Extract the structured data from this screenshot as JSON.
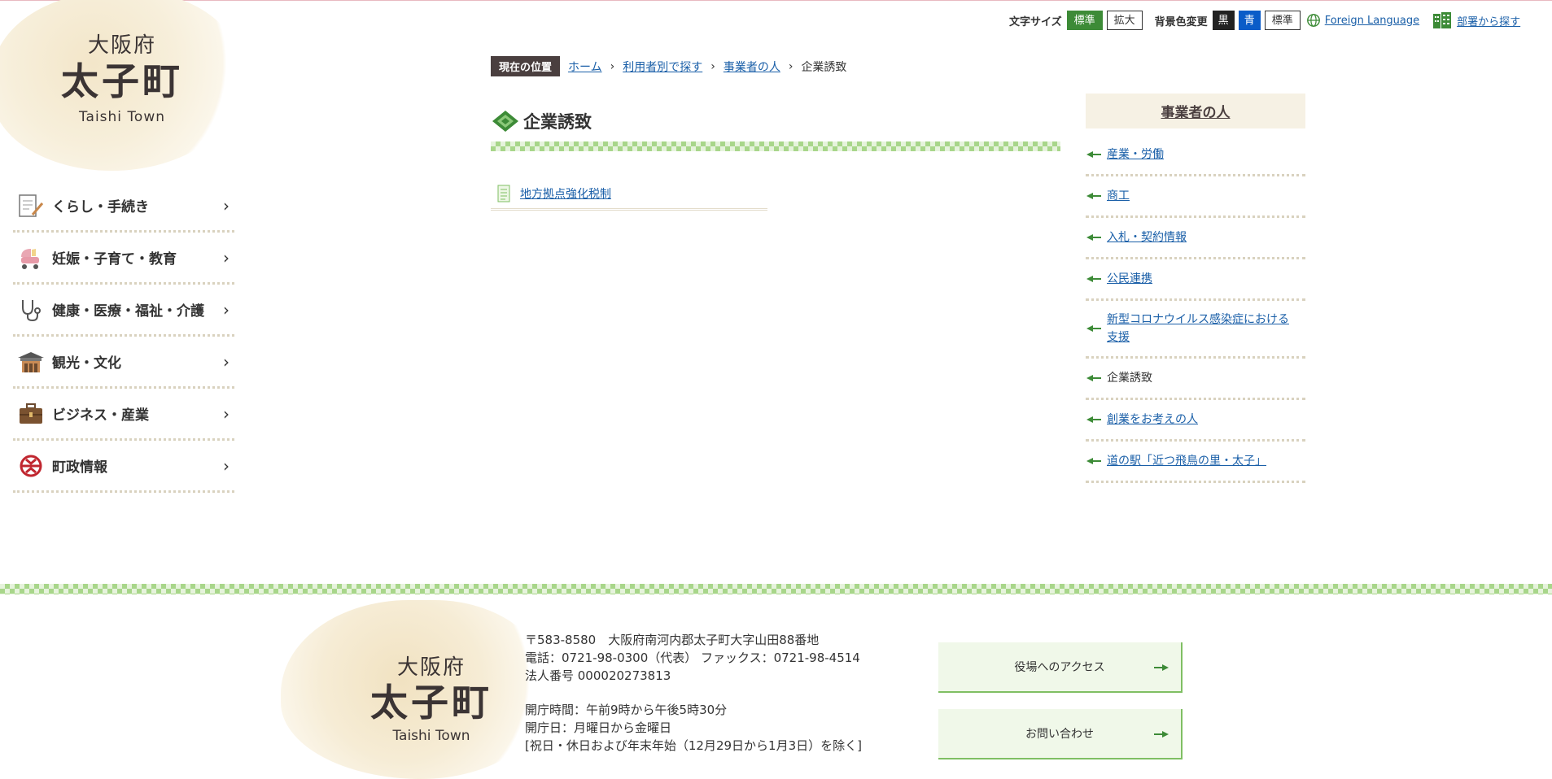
{
  "site": {
    "pref": "大阪府",
    "town": "太子町",
    "town_en": "Taishi Town"
  },
  "utility": {
    "font_size_label": "文字サイズ",
    "font_standard": "標準",
    "font_large": "拡大",
    "bg_label": "背景色変更",
    "bg_black": "黒",
    "bg_blue": "青",
    "bg_standard": "標準",
    "foreign": "Foreign Language",
    "dept": "部署から探す"
  },
  "leftnav": [
    {
      "label": "くらし・手続き"
    },
    {
      "label": "妊娠・子育て・教育"
    },
    {
      "label": "健康・医療・福祉・介護"
    },
    {
      "label": "観光・文化"
    },
    {
      "label": "ビジネス・産業"
    },
    {
      "label": "町政情報"
    }
  ],
  "breadcrumb": {
    "here": "現在の位置",
    "items": [
      "ホーム",
      "利用者別で探す",
      "事業者の人"
    ],
    "current": "企業誘致"
  },
  "main": {
    "title": "企業誘致",
    "links": [
      "地方拠点強化税制"
    ]
  },
  "side": {
    "heading": "事業者の人",
    "items": [
      {
        "label": "産業・労働"
      },
      {
        "label": "商工"
      },
      {
        "label": "入札・契約情報"
      },
      {
        "label": "公民連携"
      },
      {
        "label": "新型コロナウイルス感染症における支援"
      },
      {
        "label": "企業誘致"
      },
      {
        "label": "創業をお考えの人"
      },
      {
        "label": "道の駅「近つ飛鳥の里・太子」"
      }
    ]
  },
  "footer": {
    "address": "〒583-8580　大阪府南河内郡太子町大字山田88番地",
    "phone": "電話：0721-98-0300（代表）  ファックス：0721-98-4514",
    "corp": "法人番号 000020273813",
    "hours": "開庁時間：午前9時から午後5時30分",
    "days": "開庁日：月曜日から金曜日",
    "closed": "[祝日・休日および年末年始（12月29日から1月3日）を除く]",
    "btn_access": "役場へのアクセス",
    "btn_contact": "お問い合わせ"
  },
  "colors": {
    "accent_green": "#3d8b37",
    "link_blue": "#1a5fa8",
    "check_green": "#a8d68a"
  }
}
